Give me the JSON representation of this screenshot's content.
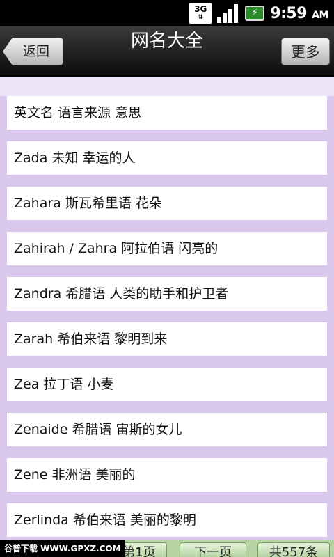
{
  "status_bar": {
    "network": "3G",
    "network_arrows": "⇅",
    "time": "9:59",
    "ampm": "AM"
  },
  "header": {
    "back_label": "返回",
    "title": "网名大全",
    "more_label": "更多"
  },
  "list": {
    "items": [
      "英文名 语言来源 意思",
      "Zada 未知 幸运的人",
      "Zahara 斯瓦希里语 花朵",
      "Zahirah / Zahra 阿拉伯语 闪亮的",
      "Zandra 希腊语 人类的助手和护卫者",
      "Zarah 希伯来语 黎明到来",
      "Zea 拉丁语 小麦",
      "Zenaide 希腊语 宙斯的女儿",
      "Zene 非洲语 美丽的",
      "Zerlinda 希伯来语 美丽的黎明"
    ]
  },
  "bottom": {
    "watermark": "谷普下载 WWW.GPXZ.COM",
    "page_label": "第1页",
    "next_label": "下一页",
    "total_label": "共557条"
  }
}
